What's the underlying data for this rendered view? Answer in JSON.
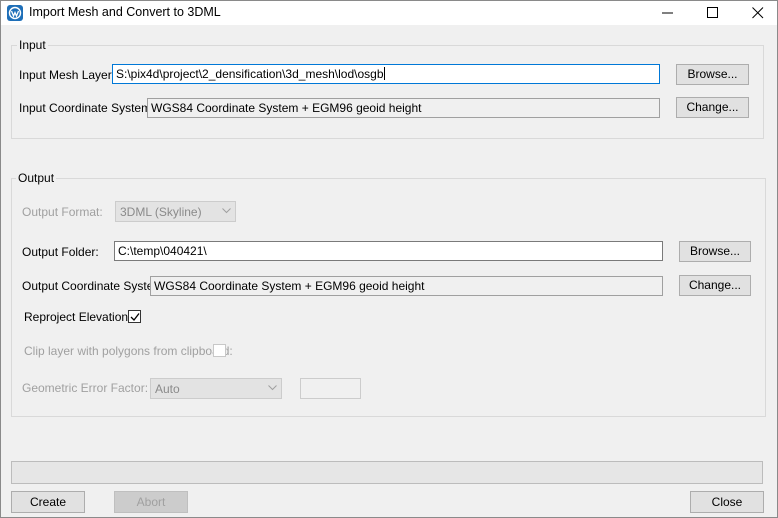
{
  "window": {
    "title": "Import Mesh and Convert to 3DML"
  },
  "input": {
    "legend": "Input",
    "mesh_layer_label": "Input Mesh Layer:",
    "mesh_layer_value": "S:\\pix4d\\project\\2_densification\\3d_mesh\\lod\\osgb",
    "browse_label": "Browse...",
    "coord_label": "Input Coordinate System:",
    "coord_value": "WGS84 Coordinate System + EGM96 geoid height",
    "change_label": "Change..."
  },
  "output": {
    "legend": "Output",
    "format_label": "Output Format:",
    "format_value": "3DML (Skyline)",
    "folder_label": "Output Folder:",
    "folder_value": "C:\\temp\\040421\\",
    "browse_label": "Browse...",
    "coord_label": "Output Coordinate System:",
    "coord_value": "WGS84 Coordinate System + EGM96 geoid height",
    "change_label": "Change...",
    "reproject_label": "Reproject Elevation:",
    "reproject_checked": true,
    "clip_label": "Clip layer with polygons from clipboard:",
    "clip_checked": false,
    "error_factor_label": "Geometric Error Factor:",
    "error_factor_value": "Auto",
    "error_factor_extra": ""
  },
  "progress": {
    "value": 0
  },
  "footer": {
    "create_label": "Create",
    "abort_label": "Abort",
    "close_label": "Close"
  },
  "icons": {
    "app": "app-logo-icon",
    "minimize": "minimize-icon",
    "maximize": "maximize-icon",
    "close": "close-icon",
    "dropdown": "chevron-down-icon",
    "check": "checkmark-icon"
  },
  "colors": {
    "app_icon": "#1e6fb8",
    "focus_border": "#0078d7",
    "progress_fill": "#06b025"
  }
}
